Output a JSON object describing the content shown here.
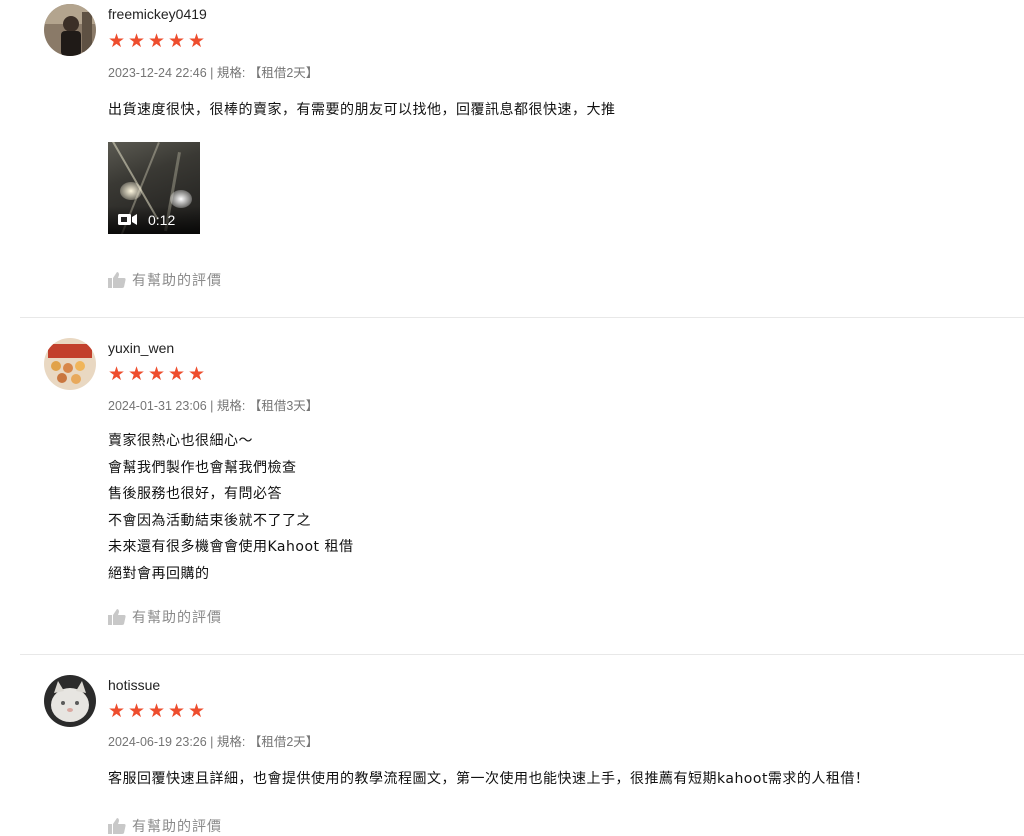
{
  "reviews": [
    {
      "username": "freemickey0419",
      "rating": 5,
      "meta": "2023-12-24 22:46 | 規格: 【租借2天】",
      "text": "出貨速度很快，很棒的賣家，有需要的朋友可以找他，回覆訊息都很快速，大推",
      "video_duration": "0:12",
      "helpful_label": "有幫助的評價"
    },
    {
      "username": "yuxin_wen",
      "rating": 5,
      "meta": "2024-01-31 23:06 | 規格: 【租借3天】",
      "text": "賣家很熱心也很細心～\n會幫我們製作也會幫我們檢查\n售後服務也很好，有問必答\n不會因為活動結束後就不了了之\n未來還有很多機會會使用Kahoot 租借\n絕對會再回購的",
      "helpful_label": "有幫助的評價"
    },
    {
      "username": "hotissue",
      "rating": 5,
      "meta": "2024-06-19 23:26 | 規格: 【租借2天】",
      "text": "客服回覆快速且詳細，也會提供使用的教學流程圖文，第一次使用也能快速上手，很推薦有短期kahoot需求的人租借！",
      "helpful_label": "有幫助的評價"
    }
  ],
  "colors": {
    "star": "#ee4d2d",
    "meta": "#757575",
    "divider": "#e8e8e8"
  },
  "icons": {
    "star": "star-icon",
    "helpful": "thumbs-up-icon",
    "video": "video-camera-icon"
  }
}
